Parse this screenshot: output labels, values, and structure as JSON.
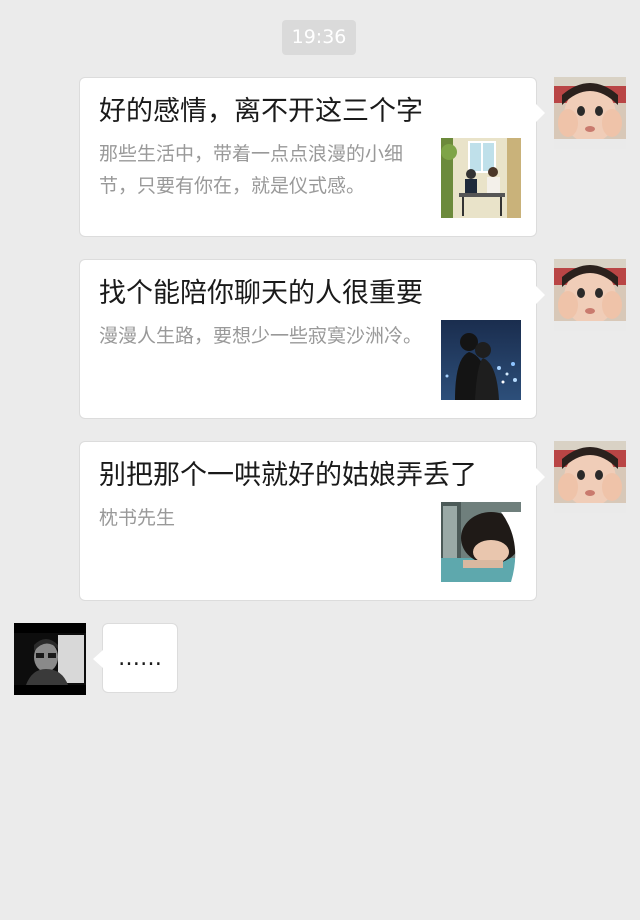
{
  "timestamp": "19:36",
  "messages": [
    {
      "title": "好的感情，离不开这三个字",
      "desc": "那些生活中，带着一点点浪漫的小细节，只要有你在，就是仪式感。"
    },
    {
      "title": "找个能陪你聊天的人很重要",
      "desc": "漫漫人生路，要想少一些寂寞沙洲冷。"
    },
    {
      "title": "别把那个一哄就好的姑娘弄丢了",
      "desc": "枕书先生"
    }
  ],
  "reply": {
    "text": "……"
  }
}
